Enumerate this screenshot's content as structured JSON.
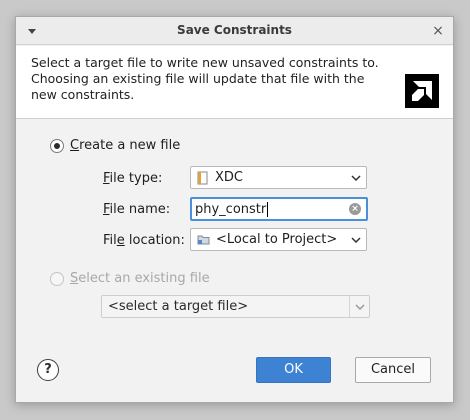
{
  "window": {
    "title": "Save Constraints",
    "close_glyph": "×"
  },
  "header": {
    "description": "Select a target file to write new unsaved constraints to. Choosing an existing file will update that file with the new constraints."
  },
  "options": {
    "create_new": {
      "label_first": "C",
      "label_rest": "reate a new file",
      "selected": true
    },
    "file_type": {
      "label_first": "F",
      "label_rest": "ile type:",
      "value": "XDC",
      "icon": "xdc-file-icon"
    },
    "file_name": {
      "label_first": "F",
      "label_rest": "ile name:",
      "value": "phy_constr"
    },
    "file_location": {
      "label_pre": "Fil",
      "label_ul": "e",
      "label_post": " location:",
      "value": "<Local to Project>",
      "icon": "folder-icon"
    },
    "select_existing": {
      "label_first": "S",
      "label_rest": "elect an existing file",
      "selected": false,
      "enabled": false
    },
    "target_file": {
      "value": "<select a target file>",
      "enabled": false
    }
  },
  "footer": {
    "help_label": "?",
    "ok_label": "OK",
    "cancel_label": "Cancel"
  },
  "colors": {
    "accent": "#3e83d3",
    "focus_border": "#4a8fd8"
  }
}
